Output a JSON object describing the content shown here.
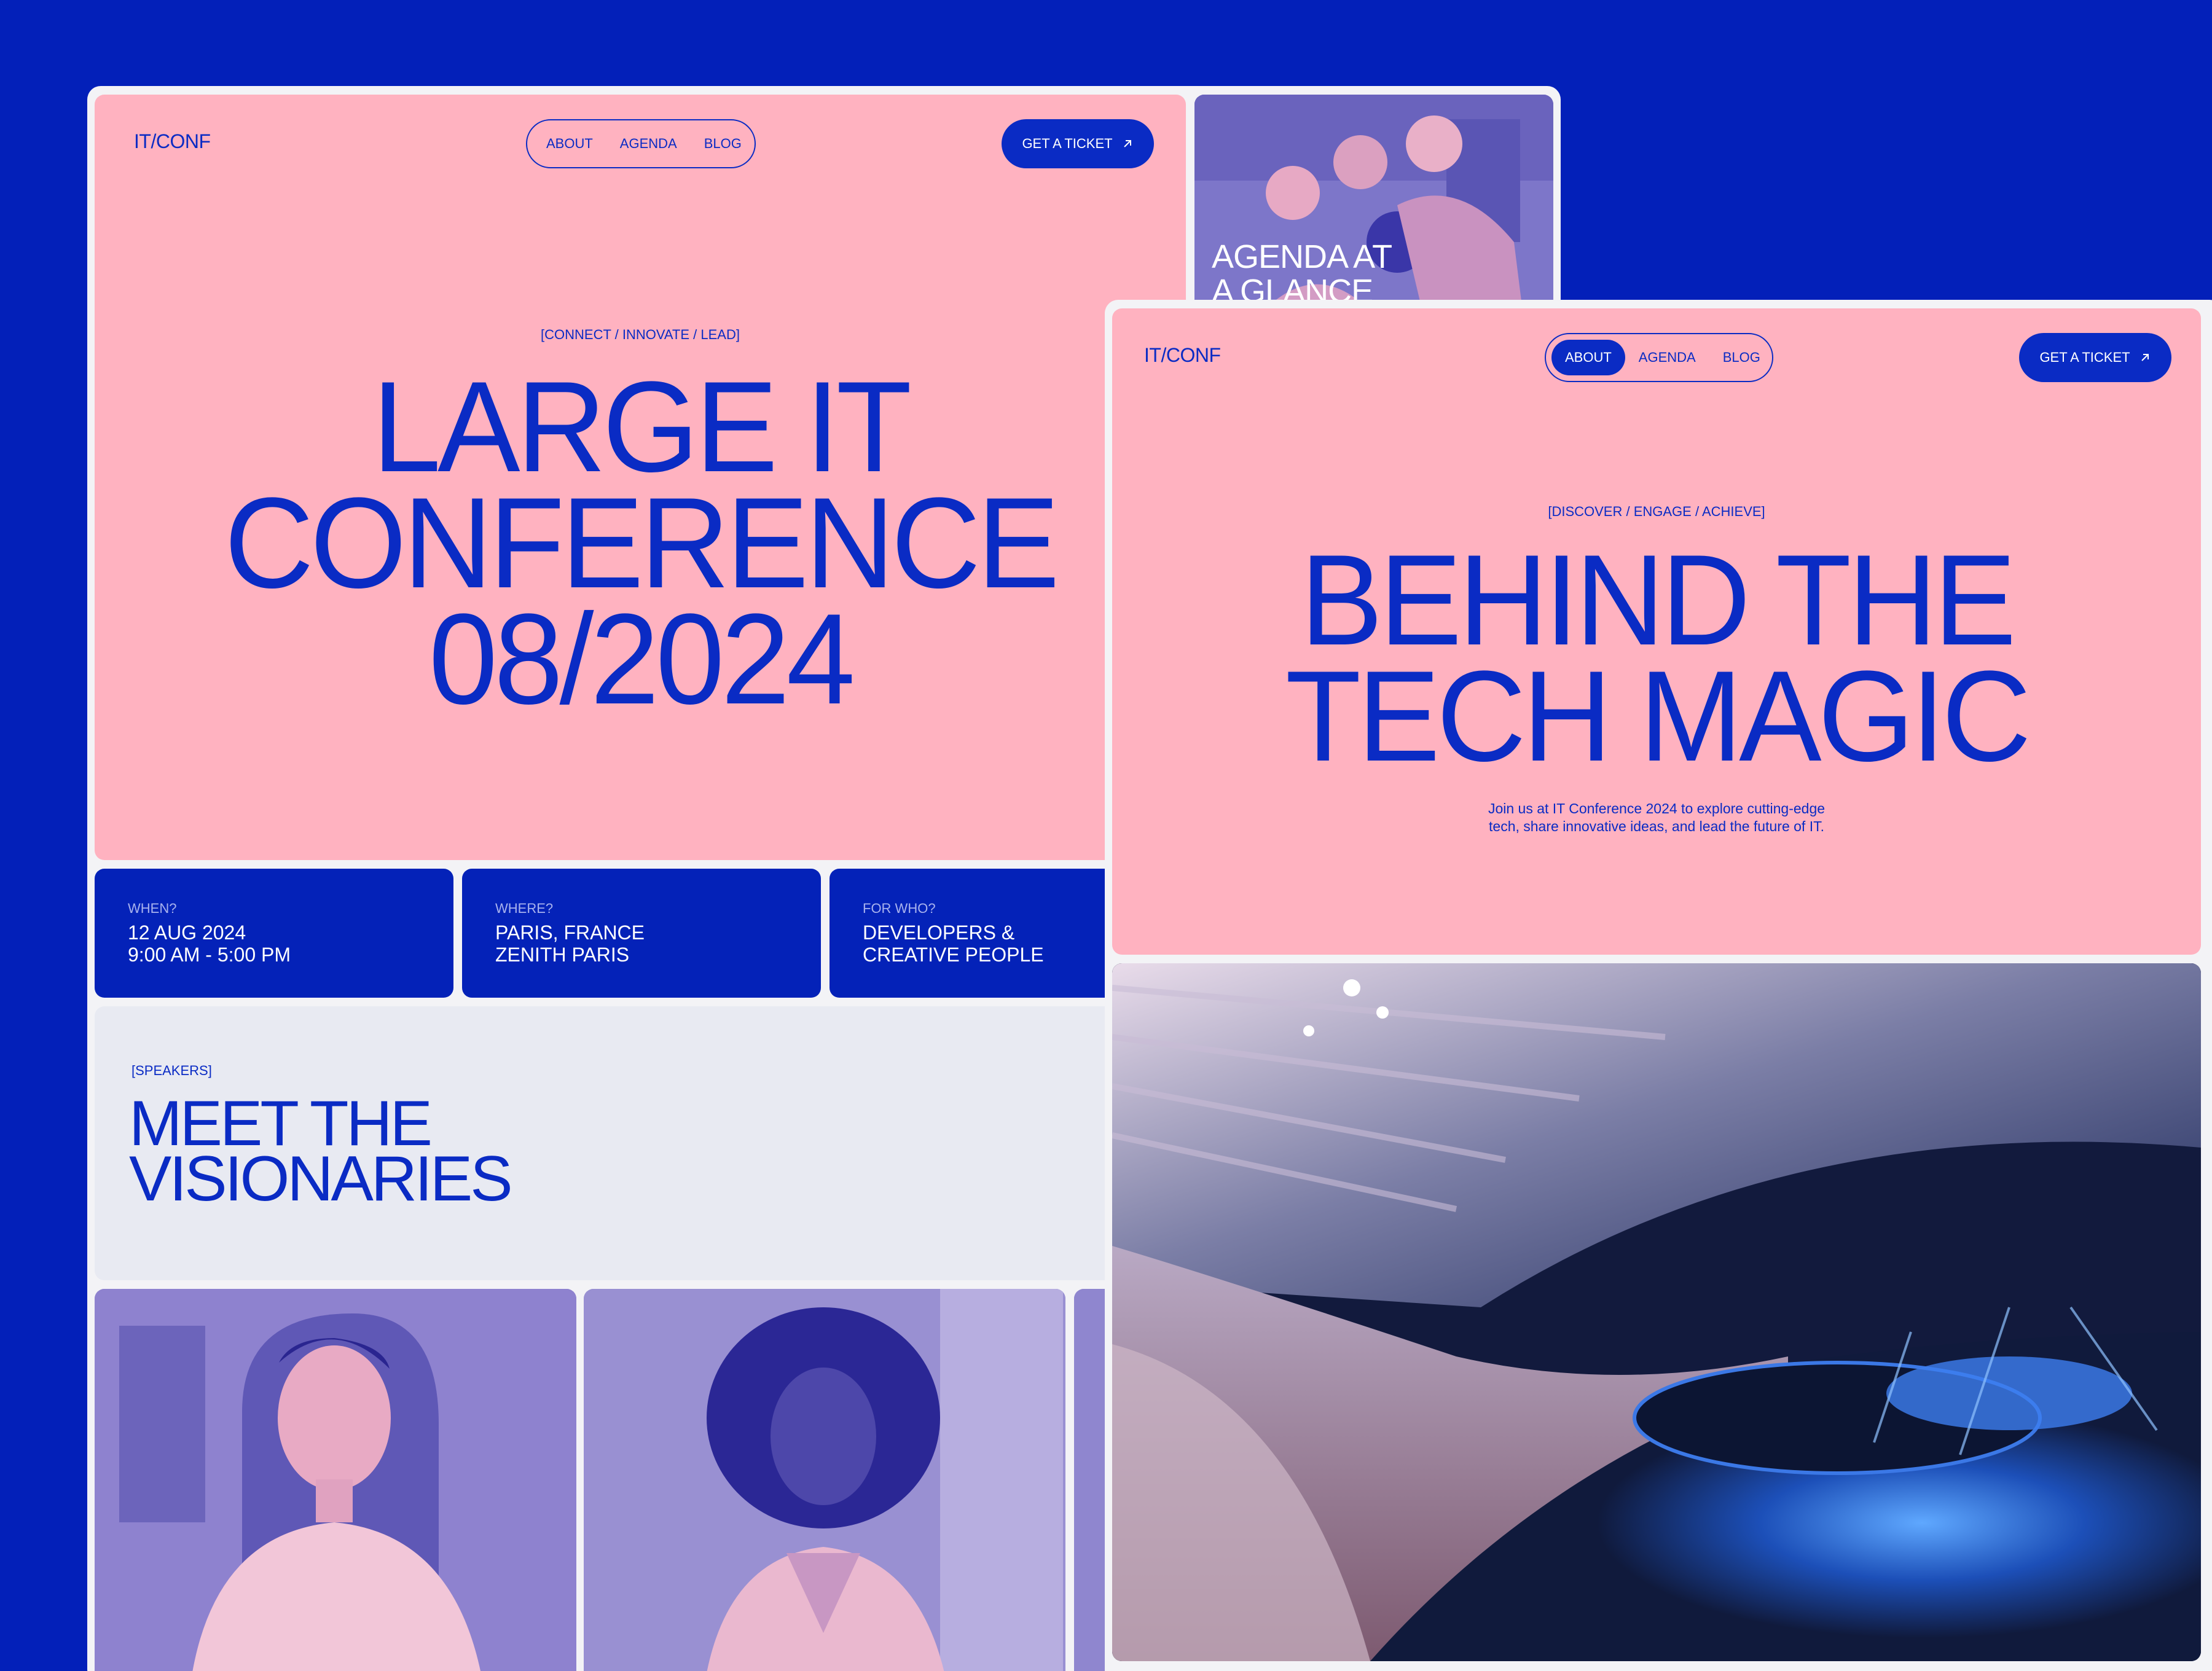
{
  "colors": {
    "background": "#0320b9",
    "accent": "#0a2bc4",
    "hero_pink": "#ffb2c0",
    "card_blue": "#0422b8",
    "speaker_bg": "#e8eaf2"
  },
  "page_a": {
    "logo": "IT/CONF",
    "nav": [
      "ABOUT",
      "AGENDA",
      "BLOG"
    ],
    "ticket_label": "GET A TICKET",
    "tag": "[CONNECT / INNOVATE / LEAD]",
    "headline": [
      "LARGE IT",
      "CONFERENCE",
      "08/2024"
    ],
    "info": [
      {
        "label": "WHEN?",
        "value": [
          "12 AUG 2024",
          "9:00 AM - 5:00 PM"
        ]
      },
      {
        "label": "WHERE?",
        "value": [
          "PARIS, FRANCE",
          "ZENITH PARIS"
        ]
      },
      {
        "label": "FOR WHO?",
        "value": [
          "DEVELOPERS &",
          "CREATIVE PEOPLE"
        ]
      }
    ],
    "agenda_card": [
      "AGENDA AT",
      "A GLANCE"
    ],
    "speakers": {
      "tag": "[SPEAKERS]",
      "title": [
        "MEET THE",
        "VISIONARIES"
      ]
    }
  },
  "page_b": {
    "logo": "IT/CONF",
    "nav": [
      "ABOUT",
      "AGENDA",
      "BLOG"
    ],
    "active_nav": "ABOUT",
    "ticket_label": "GET A TICKET",
    "tag": "[DISCOVER / ENGAGE / ACHIEVE]",
    "headline": [
      "BEHIND THE",
      "TECH MAGIC"
    ],
    "subtitle": [
      "Join us at IT Conference 2024 to explore cutting-edge",
      "tech, share innovative ideas, and lead the future of IT."
    ]
  },
  "icons": {
    "ticket_arrow": "arrow-up-right-icon"
  }
}
